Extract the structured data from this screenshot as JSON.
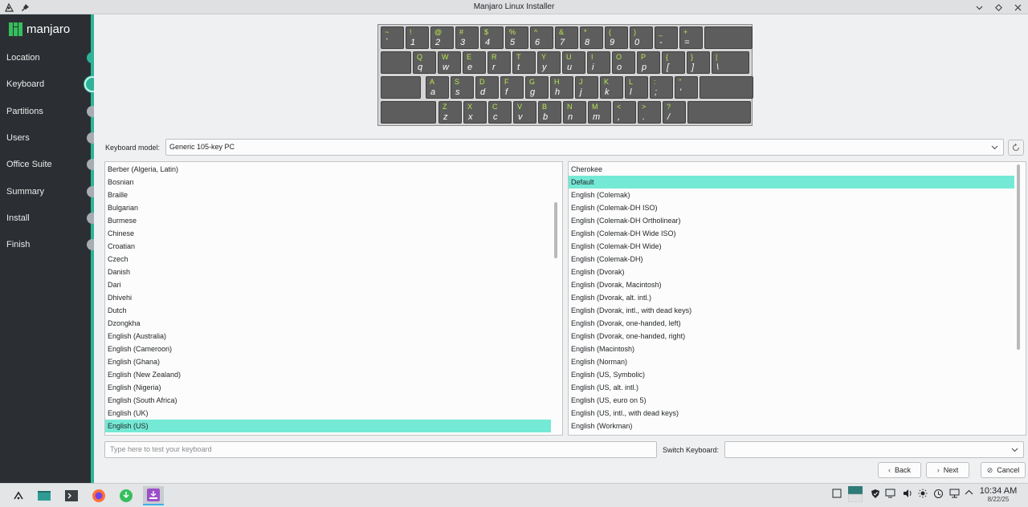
{
  "window": {
    "title": "Manjaro Linux Installer",
    "controls": [
      "chevron-down",
      "diamond",
      "close"
    ]
  },
  "sidebar": {
    "brand": "manjaro",
    "items": [
      {
        "label": "Location",
        "state": "done"
      },
      {
        "label": "Keyboard",
        "state": "current"
      },
      {
        "label": "Partitions",
        "state": "pending"
      },
      {
        "label": "Users",
        "state": "pending"
      },
      {
        "label": "Office Suite",
        "state": "pending"
      },
      {
        "label": "Summary",
        "state": "pending"
      },
      {
        "label": "Install",
        "state": "pending"
      },
      {
        "label": "Finish",
        "state": "pending"
      }
    ]
  },
  "keyboard_preview": {
    "row1": [
      [
        "~",
        "`"
      ],
      [
        "!",
        "1"
      ],
      [
        "@",
        "2"
      ],
      [
        "#",
        "3"
      ],
      [
        "$",
        "4"
      ],
      [
        "%",
        "5"
      ],
      [
        "^",
        "6"
      ],
      [
        "&",
        "7"
      ],
      [
        "*",
        "8"
      ],
      [
        "(",
        "9"
      ],
      [
        ")",
        "0"
      ],
      [
        "_",
        "-"
      ],
      [
        "+",
        "="
      ]
    ],
    "row2": [
      [
        "Q",
        "q"
      ],
      [
        "W",
        "w"
      ],
      [
        "E",
        "e"
      ],
      [
        "R",
        "r"
      ],
      [
        "T",
        "t"
      ],
      [
        "Y",
        "y"
      ],
      [
        "U",
        "u"
      ],
      [
        "I",
        "i"
      ],
      [
        "O",
        "o"
      ],
      [
        "P",
        "p"
      ],
      [
        "{",
        "["
      ],
      [
        "}",
        "]"
      ],
      [
        "|",
        "\\"
      ]
    ],
    "row3": [
      [
        "A",
        "a"
      ],
      [
        "S",
        "s"
      ],
      [
        "D",
        "d"
      ],
      [
        "F",
        "f"
      ],
      [
        "G",
        "g"
      ],
      [
        "H",
        "h"
      ],
      [
        "J",
        "j"
      ],
      [
        "K",
        "k"
      ],
      [
        "L",
        "l"
      ],
      [
        ":",
        ";"
      ],
      [
        "\"",
        "'"
      ]
    ],
    "row4": [
      [
        "Z",
        "z"
      ],
      [
        "X",
        "x"
      ],
      [
        "C",
        "c"
      ],
      [
        "V",
        "v"
      ],
      [
        "B",
        "b"
      ],
      [
        "N",
        "n"
      ],
      [
        "M",
        "m"
      ],
      [
        "<",
        ","
      ],
      [
        ">",
        "."
      ],
      [
        "?",
        "/"
      ]
    ]
  },
  "model": {
    "label": "Keyboard model:",
    "value": "Generic 105-key PC"
  },
  "layouts": {
    "items": [
      "Berber (Algeria, Latin)",
      "Bosnian",
      "Braille",
      "Bulgarian",
      "Burmese",
      "Chinese",
      "Croatian",
      "Czech",
      "Danish",
      "Dari",
      "Dhivehi",
      "Dutch",
      "Dzongkha",
      "English (Australia)",
      "English (Cameroon)",
      "English (Ghana)",
      "English (New Zealand)",
      "English (Nigeria)",
      "English (South Africa)",
      "English (UK)",
      "English (US)"
    ],
    "selected": "English (US)"
  },
  "variants": {
    "items": [
      "Cherokee",
      "Default",
      "English (Colemak)",
      "English (Colemak-DH ISO)",
      "English (Colemak-DH Ortholinear)",
      "English (Colemak-DH Wide ISO)",
      "English (Colemak-DH Wide)",
      "English (Colemak-DH)",
      "English (Dvorak)",
      "English (Dvorak, Macintosh)",
      "English (Dvorak, alt. intl.)",
      "English (Dvorak, intl., with dead keys)",
      "English (Dvorak, one-handed, left)",
      "English (Dvorak, one-handed, right)",
      "English (Macintosh)",
      "English (Norman)",
      "English (US, Symbolic)",
      "English (US, alt. intl.)",
      "English (US, euro on 5)",
      "English (US, intl., with dead keys)",
      "English (Workman)"
    ],
    "selected": "Default"
  },
  "test_input": {
    "placeholder": "Type here to test your keyboard",
    "value": ""
  },
  "switch_keyboard": {
    "label": "Switch Keyboard:",
    "value": ""
  },
  "buttons": {
    "back": "Back",
    "next": "Next",
    "cancel": "Cancel"
  },
  "taskbar": {
    "time": "10:34 AM",
    "date": "8/22/25"
  },
  "colors": {
    "sidebar_bg": "#2b2f33",
    "accent": "#2eb398",
    "selection": "#74e9d5",
    "key_legend": "#b7e64f"
  }
}
